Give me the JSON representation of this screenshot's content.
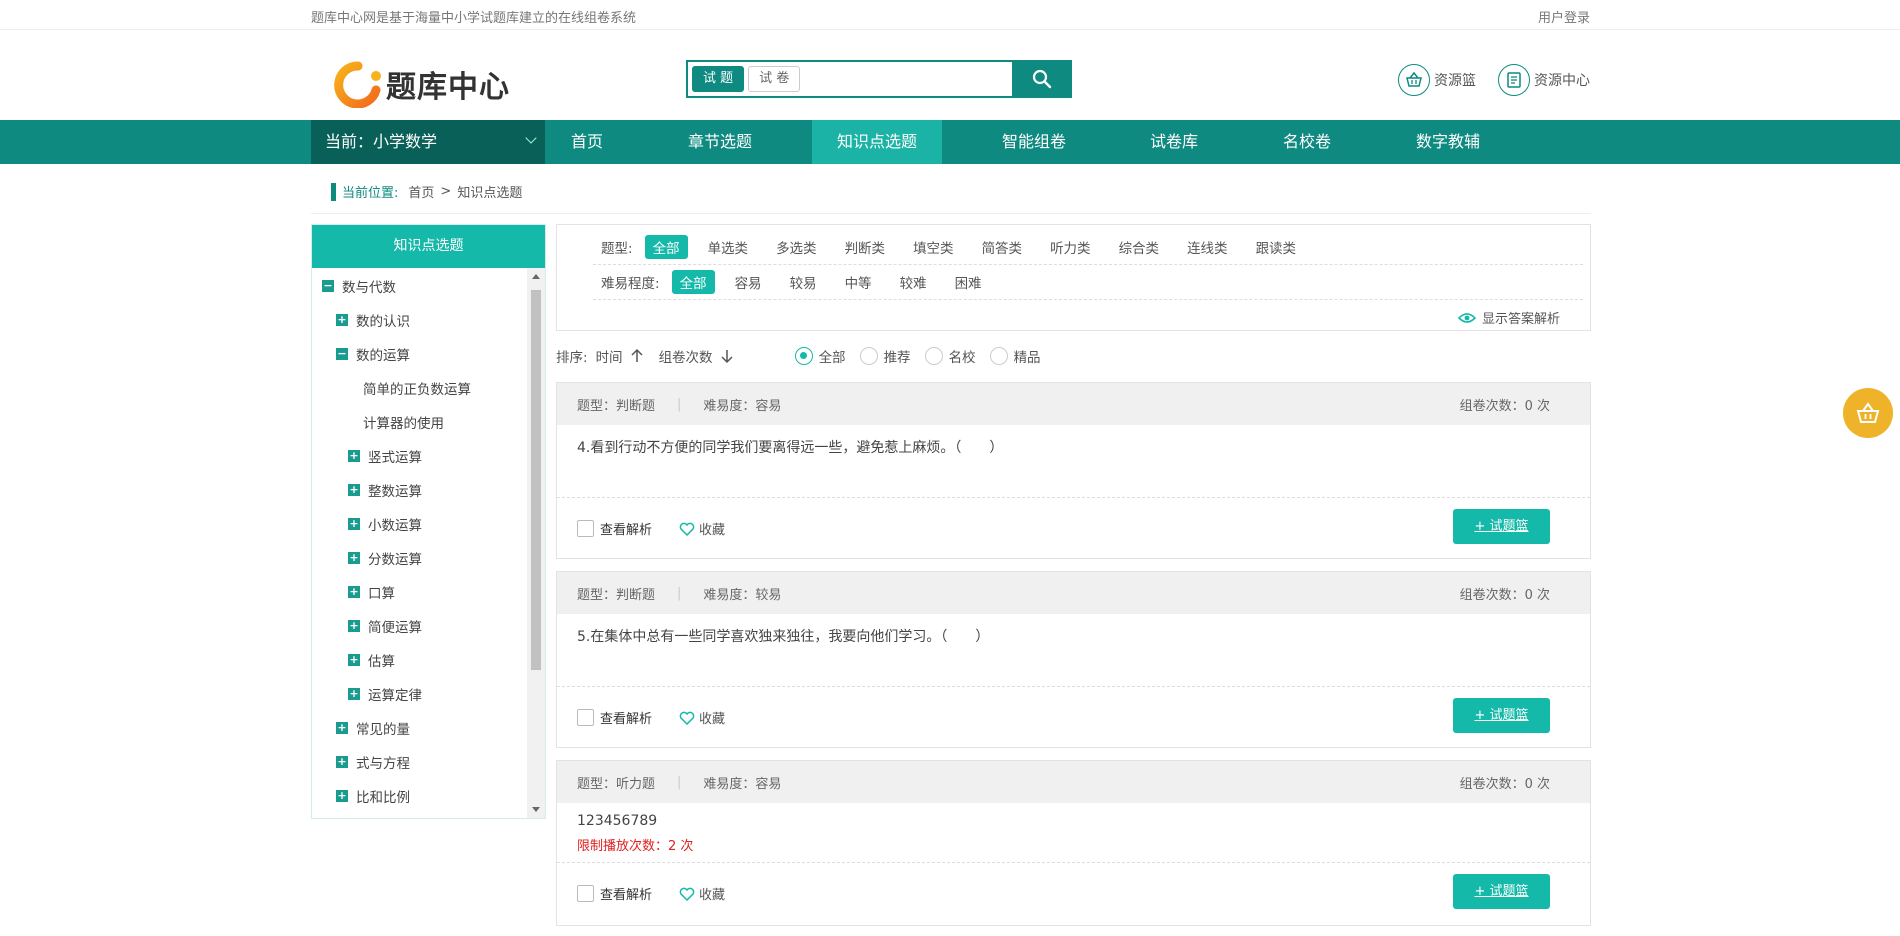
{
  "topbar": {
    "intro": "题库中心网是基于海量中小学试题库建立的在线组卷系统",
    "login": "用户登录"
  },
  "logo": {
    "text": "题库中心"
  },
  "search": {
    "tab_questions": "试 题",
    "tab_papers": "试 卷",
    "placeholder": ""
  },
  "header_links": {
    "basket": "资源篮",
    "center": "资源中心"
  },
  "nav": {
    "current": "当前：小学数学",
    "items": [
      "首页",
      "章节选题",
      "知识点选题",
      "智能组卷",
      "试卷库",
      "名校卷",
      "数字教辅"
    ],
    "active_index": 2
  },
  "breadcrumb": {
    "label": "当前位置:",
    "home": "首页",
    "sep": ">",
    "page": "知识点选题"
  },
  "sidebar": {
    "title": "知识点选题",
    "tree": [
      {
        "label": "数与代数",
        "state": "−",
        "level": 0
      },
      {
        "label": "数的认识",
        "state": "+",
        "level": 1
      },
      {
        "label": "数的运算",
        "state": "−",
        "level": 1
      },
      {
        "label": "简单的正负数运算",
        "state": "",
        "level": 2
      },
      {
        "label": "计算器的使用",
        "state": "",
        "level": 2
      },
      {
        "label": "竖式运算",
        "state": "+",
        "level": 2
      },
      {
        "label": "整数运算",
        "state": "+",
        "level": 2
      },
      {
        "label": "小数运算",
        "state": "+",
        "level": 2
      },
      {
        "label": "分数运算",
        "state": "+",
        "level": 2
      },
      {
        "label": "口算",
        "state": "+",
        "level": 2
      },
      {
        "label": "简便运算",
        "state": "+",
        "level": 2
      },
      {
        "label": "估算",
        "state": "+",
        "level": 2
      },
      {
        "label": "运算定律",
        "state": "+",
        "level": 2
      },
      {
        "label": "常见的量",
        "state": "+",
        "level": 1
      },
      {
        "label": "式与方程",
        "state": "+",
        "level": 1
      },
      {
        "label": "比和比例",
        "state": "+",
        "level": 1
      }
    ]
  },
  "filters": {
    "type_label": "题型:",
    "types": [
      "全部",
      "单选类",
      "多选类",
      "判断类",
      "填空类",
      "简答类",
      "听力类",
      "综合类",
      "连线类",
      "跟读类"
    ],
    "difficulty_label": "难易程度:",
    "difficulties": [
      "全部",
      "容易",
      "较易",
      "中等",
      "较难",
      "困难"
    ],
    "show_answer": "显示答案解析"
  },
  "sort": {
    "label": "排序:",
    "time": "时间",
    "count": "组卷次数",
    "options": [
      "全部",
      "推荐",
      "名校",
      "精品"
    ],
    "selected": 0
  },
  "questions": [
    {
      "type": "题型：判断题",
      "difficulty": "难易度：容易",
      "count": "组卷次数：0 次",
      "text": "4.看到行动不方便的同学我们要离得远一些，避免惹上麻烦。（　　）",
      "view": "查看解析",
      "fav": "收藏",
      "add": "+ 试题篮"
    },
    {
      "type": "题型：判断题",
      "difficulty": "难易度：较易",
      "count": "组卷次数：0 次",
      "text": "5.在集体中总有一些同学喜欢独来独往，我要向他们学习。（　　）",
      "view": "查看解析",
      "fav": "收藏",
      "add": "+ 试题篮"
    },
    {
      "type": "题型：听力题",
      "difficulty": "难易度：容易",
      "count": "组卷次数：0 次",
      "text": "123456789",
      "limit_label": "限制播放次数：",
      "limit_num": "2",
      "limit_unit": " 次",
      "view": "查看解析",
      "fav": "收藏",
      "add": "+ 试题篮"
    }
  ],
  "colors": {
    "primary": "#0e8a80",
    "accent": "#15b9a9",
    "cart": "#efb32a"
  }
}
